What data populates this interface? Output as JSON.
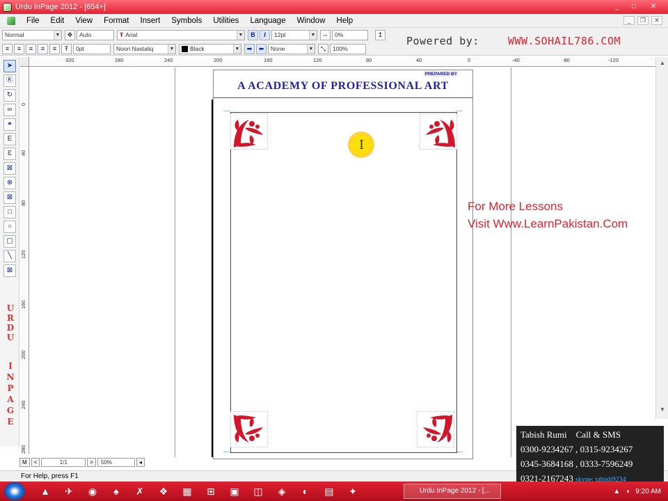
{
  "window": {
    "title": "Urdu InPage 2012 - [654+]",
    "minimize": "_",
    "maximize": "□",
    "close": "✕"
  },
  "menu": {
    "items": [
      "File",
      "Edit",
      "View",
      "Format",
      "Insert",
      "Symbols",
      "Utilities",
      "Language",
      "Window",
      "Help"
    ]
  },
  "toolbar": {
    "style_combo": "Normal",
    "leading_combo": "Auto",
    "font_combo": "Arial",
    "bold_label": "B",
    "italic_label": "I",
    "size_combo": "12pt",
    "tracking_combo": "0%",
    "indent_combo": "0pt",
    "urdu_font_combo": "Noori Nastaliq",
    "color_combo": "Black",
    "underline_combo": "None",
    "scale_combo": "100%"
  },
  "branding": {
    "powered_by": "Powered by:",
    "url": "WWW.SOHAIL786.COM"
  },
  "rulers": {
    "horizontal": [
      "320",
      "280",
      "240",
      "200",
      "160",
      "120",
      "80",
      "40",
      "0",
      "-40",
      "-80",
      "-120"
    ],
    "vertical": [
      "0",
      "40",
      "80",
      "120",
      "160",
      "200",
      "240",
      "280"
    ]
  },
  "document": {
    "prepared_by": "PREPARED BY",
    "heading": "A ACADEMY OF PROFESSIONAL ART"
  },
  "side_text": {
    "line1": "For More Lessons",
    "line2": "Visit Www.LearnPakistan.Com"
  },
  "palette": {
    "urdu_letters": [
      "U",
      "R",
      "D",
      "U"
    ],
    "inpage_letters": [
      "I",
      "N",
      "P",
      "A",
      "G",
      "E"
    ]
  },
  "page_nav": {
    "m_label": "M",
    "prev": "<",
    "page_field": "1/1",
    "next": ">",
    "zoom": "50%"
  },
  "status": {
    "help_text": "For Help, press F1"
  },
  "contact": {
    "name": "Tabish Rumi",
    "call_label": "Call & SMS",
    "phone1": "0300-9234267",
    "phone2": "0315-9234267",
    "phone3": "0345-3684168",
    "phone4": "0333-7596249",
    "phone5": "0321-2167243",
    "skype": "skype: tabish9234"
  },
  "taskbar": {
    "active_window": "Urdu InPage 2012 - [...",
    "clock": "9:20 AM"
  },
  "colors": {
    "title_red": "#e42232",
    "heading_blue": "#2020a8",
    "lesson_red": "#ee1f2a",
    "ornament_red": "#d3162c"
  }
}
